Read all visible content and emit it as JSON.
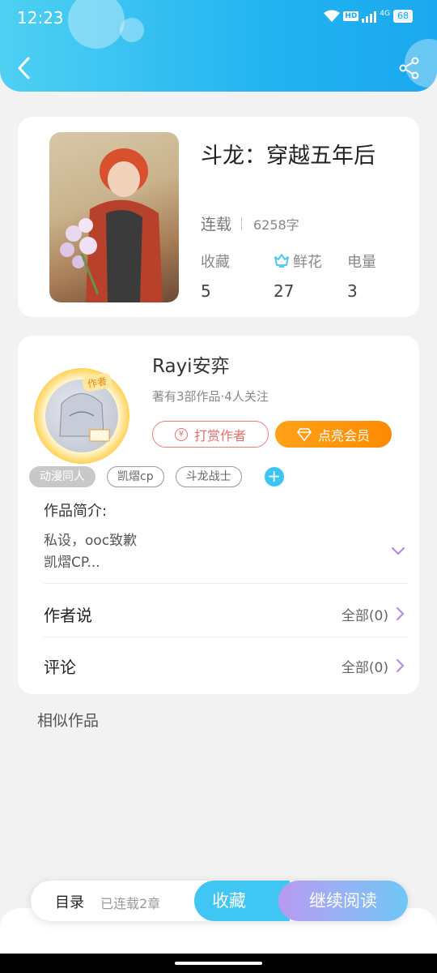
{
  "status_bar": {
    "time": "12:23",
    "hd": "HD",
    "network": "4G",
    "battery": "68"
  },
  "book": {
    "title": "斗龙：穿越五年后",
    "status": "连载",
    "word_count": "6258字",
    "stats": [
      {
        "label": "收藏",
        "value": "5"
      },
      {
        "label": "鲜花",
        "value": "27"
      },
      {
        "label": "电量",
        "value": "3"
      }
    ]
  },
  "author": {
    "badge": "作者",
    "name": "Rayi安弈",
    "meta": "著有3部作品·4人关注",
    "tip_label": "打赏作者",
    "tip_icon": "¥",
    "vip_label": "点亮会员"
  },
  "tags": [
    "动漫同人",
    "凯熠cp",
    "斗龙战士"
  ],
  "intro": {
    "label": "作品简介:",
    "line1": "私设，ooc致歉",
    "line2": "凯熠CP..."
  },
  "rows": {
    "author_says": {
      "label": "作者说",
      "value": "全部(0)"
    },
    "comments": {
      "label": "评论",
      "value": "全部(0)"
    }
  },
  "similar_label": "相似作品",
  "bottom": {
    "toc": "目录",
    "chapters": "已连载2章",
    "favorite": "收藏",
    "continue": "继续阅读"
  },
  "colors": {
    "header": "#23b4f0",
    "accent_blue": "#3fc6f3",
    "tip_red": "#ee6b6b",
    "vip_orange": "#ff8a00"
  }
}
